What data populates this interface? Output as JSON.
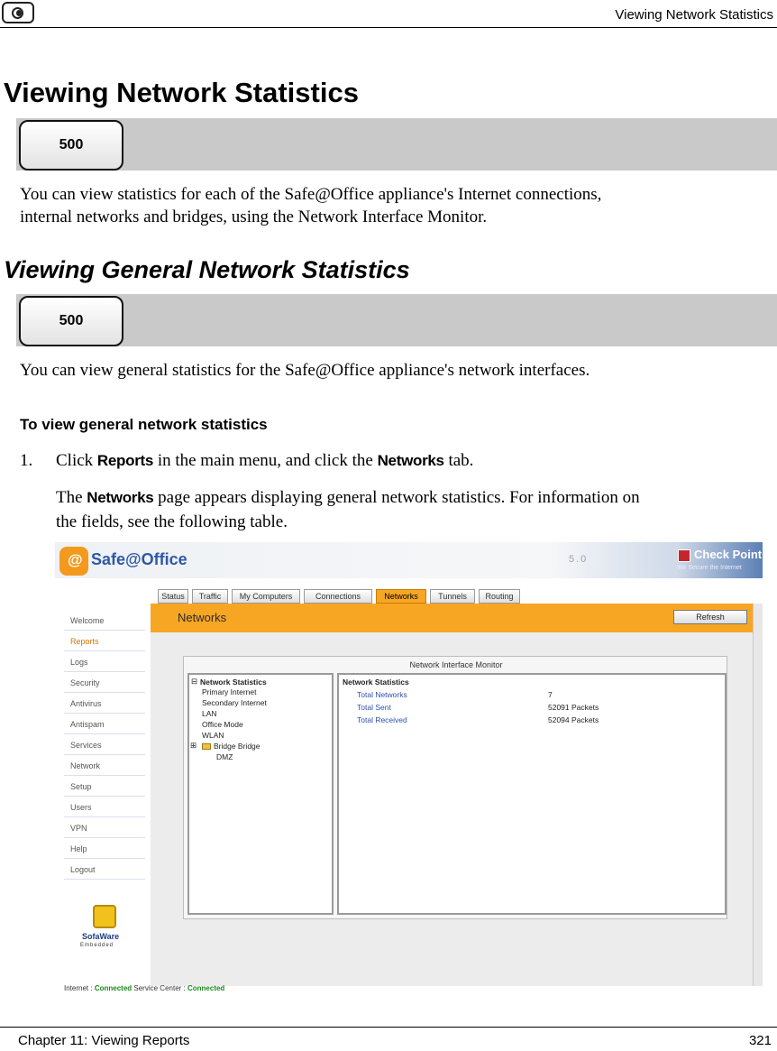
{
  "header": {
    "icon": "cd-icon",
    "title": "Viewing Network Statistics"
  },
  "section1": {
    "heading": "Viewing Network Statistics",
    "model": "500",
    "text1": "You can view statistics for each of the Safe@Office appliance's Internet connections,",
    "text2": "internal networks and bridges, using the Network Interface Monitor."
  },
  "section2": {
    "heading": "Viewing General Network Statistics",
    "model": "500",
    "text": "You can view general statistics for the Safe@Office appliance's network interfaces."
  },
  "procedure": {
    "heading": "To view general network statistics",
    "step_number": "1.",
    "step_part1": "Click ",
    "step_ui1": "Reports",
    "step_part2": " in the main menu, and click the ",
    "step_ui2": "Networks",
    "step_part3": " tab.",
    "sub_part1": "The ",
    "sub_ui": "Networks",
    "sub_part2": " page appears displaying general network statistics. For information on",
    "sub_line2": "the fields, see the following table."
  },
  "screenshot": {
    "brand": "Safe@Office",
    "version": "5.0",
    "vendor": "Check Point",
    "vendor_tagline": "We Secure the Internet",
    "tabs": [
      "Status",
      "Traffic",
      "My Computers",
      "Connections",
      "Networks",
      "Tunnels",
      "Routing"
    ],
    "active_tab": "Networks",
    "nav": [
      "Welcome",
      "Reports",
      "Logs",
      "Security",
      "Antivirus",
      "Antispam",
      "Services",
      "Network",
      "Setup",
      "Users",
      "VPN",
      "Help",
      "Logout"
    ],
    "active_nav": "Reports",
    "page_title": "Networks",
    "refresh_label": "Refresh",
    "monitor_title": "Network Interface Monitor",
    "tree": {
      "root": "Network Statistics",
      "items": [
        "Primary Internet",
        "Secondary Internet",
        "LAN",
        "Office Mode",
        "WLAN",
        "Bridge Bridge",
        "DMZ"
      ]
    },
    "stats_heading": "Network Statistics",
    "stats": [
      {
        "label": "Total Networks",
        "value": "7"
      },
      {
        "label": "Total Sent",
        "value": "52091 Packets"
      },
      {
        "label": "Total Received",
        "value": "52094 Packets"
      }
    ],
    "sofaware": "SofaWare",
    "sofaware_sub": "Embedded",
    "status": {
      "internet_label": "Internet :",
      "internet_value": "Connected",
      "service_label": "Service Center :",
      "service_value": "Connected"
    },
    "colors": {
      "accent": "#f7a623",
      "brand_blue": "#2e58a5",
      "link_blue": "#2f4fb0",
      "status_green": "#1a8a1a"
    }
  },
  "footer": {
    "chapter": "Chapter 11: Viewing Reports",
    "page": "321"
  }
}
